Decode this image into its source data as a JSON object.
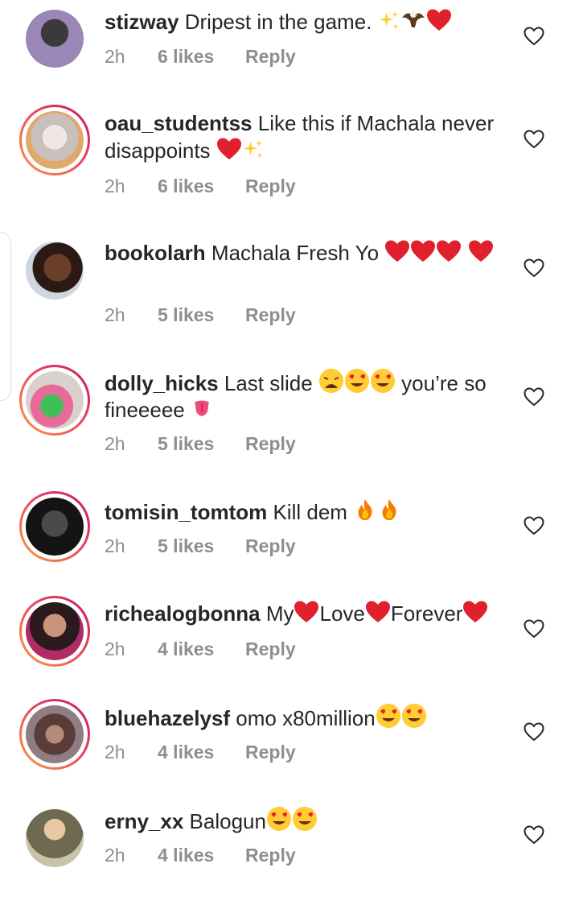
{
  "comments": [
    {
      "username": "stizway",
      "text": "Dripest in the game.",
      "emojis": [
        "sparkles",
        "eagle",
        "red-heart"
      ],
      "time": "2h",
      "likes": "6 likes",
      "reply": "Reply",
      "story_ring": false
    },
    {
      "username": "oau_studentss",
      "text": "Like this if Machala never disappoints",
      "emojis": [
        "red-heart",
        "sparkles"
      ],
      "time": "2h",
      "likes": "6 likes",
      "reply": "Reply",
      "story_ring": true
    },
    {
      "username": "bookolarh",
      "text": "Machala Fresh Yo",
      "emojis": [
        "red-heart",
        "red-heart",
        "red-heart",
        "red-heart"
      ],
      "time": "2h",
      "likes": "5 likes",
      "reply": "Reply",
      "story_ring": false
    },
    {
      "username": "dolly_hicks",
      "text_before": "Last slide",
      "text_after": "you’re so fineeeee",
      "emojis": [
        "weary-face",
        "heart-eyes",
        "heart-eyes",
        "tongue"
      ],
      "time": "2h",
      "likes": "5 likes",
      "reply": "Reply",
      "story_ring": true
    },
    {
      "username": "tomisin_tomtom",
      "text": "Kill dem",
      "emojis": [
        "fire",
        "fire"
      ],
      "time": "2h",
      "likes": "5 likes",
      "reply": "Reply",
      "story_ring": true
    },
    {
      "username": "richealogbonna",
      "parts": [
        "My",
        "Love",
        "Forever"
      ],
      "emojis": [
        "red-heart",
        "red-heart",
        "red-heart"
      ],
      "time": "2h",
      "likes": "4 likes",
      "reply": "Reply",
      "story_ring": true
    },
    {
      "username": "bluehazelysf",
      "text": "omo x80million",
      "emojis": [
        "heart-eyes",
        "heart-eyes"
      ],
      "time": "2h",
      "likes": "4 likes",
      "reply": "Reply",
      "story_ring": true
    },
    {
      "username": "erny_xx",
      "text": "Balogun",
      "emojis": [
        "heart-eyes",
        "heart-eyes"
      ],
      "time": "2h",
      "likes": "4 likes",
      "reply": "Reply",
      "story_ring": false
    }
  ],
  "icons": {
    "like": "heart-outline-icon"
  },
  "colors": {
    "text": "#262626",
    "meta": "#8e8e8e",
    "heart": "#e0202d",
    "story_ring_start": "#f9a03f",
    "story_ring_end": "#c2185b"
  }
}
